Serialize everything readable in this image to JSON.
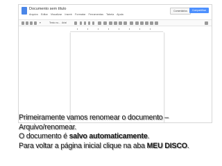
{
  "screenshot": {
    "doc_title": "Documento sem título",
    "menu": [
      "Arquivo",
      "Editar",
      "Visualizar",
      "Inserir",
      "Formatar",
      "Ferramentas",
      "Tabela",
      "Ajuda"
    ],
    "comments_label": "Comentários",
    "share_label": "Compartilhar",
    "font_name": "Texto no...",
    "font_face": "Arial"
  },
  "caption": {
    "line1": "Primeiramente vamos renomear o documento –",
    "line2": "Arquivo/renomear.",
    "line3_prefix": "O documento é ",
    "line3_bold": "salvo automaticamente",
    "line3_suffix": ".",
    "line4_prefix": "Para voltar a página inicial clique na aba ",
    "line4_bold": "MEU DISCO",
    "line4_suffix": "."
  },
  "colors": {
    "share_button": "#4d90fe",
    "app_icon": "#4a86e8"
  }
}
